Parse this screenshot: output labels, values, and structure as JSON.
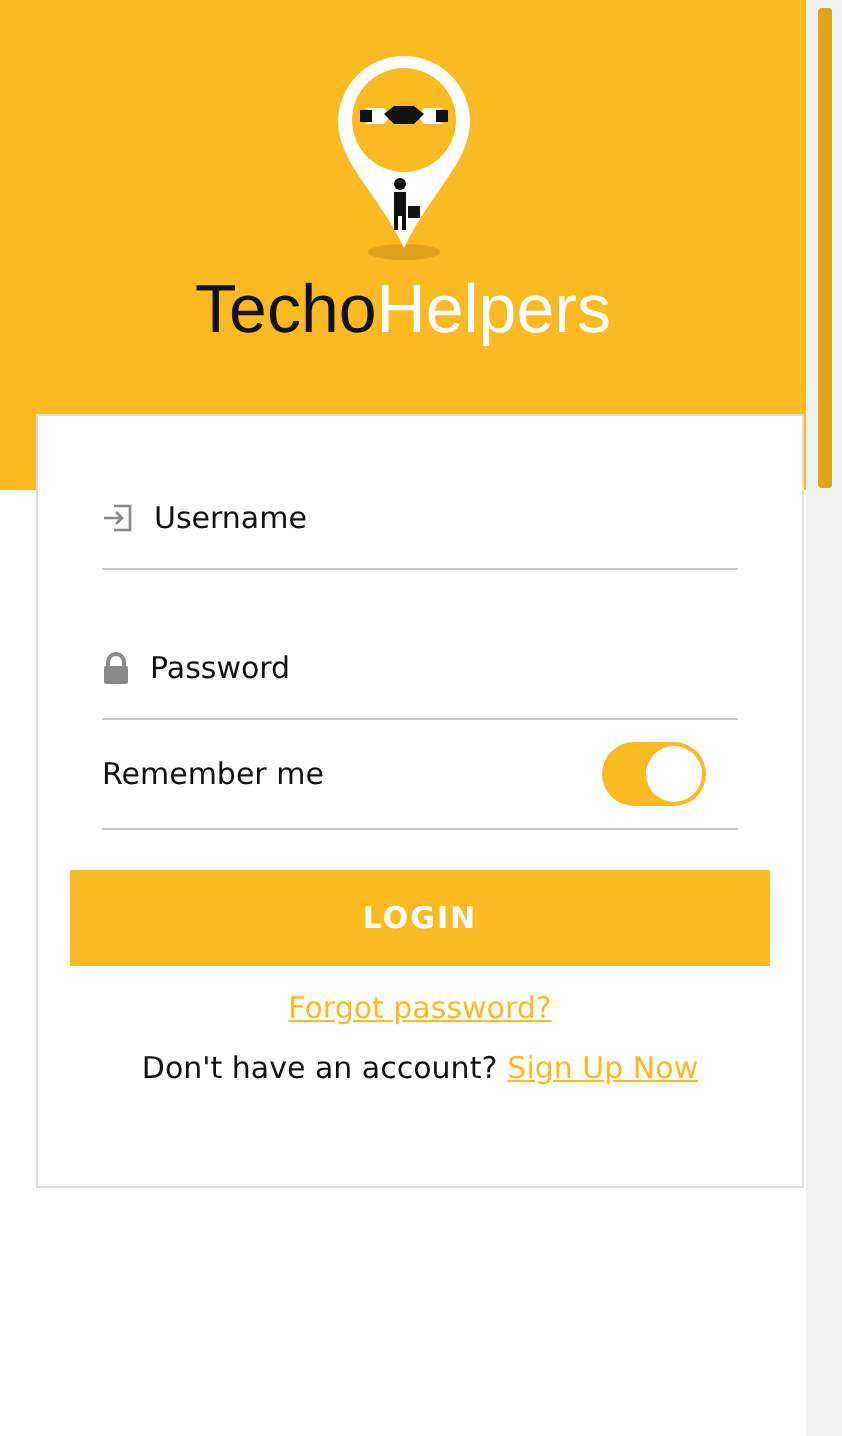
{
  "brand": {
    "name_dark": "Techo",
    "name_light": "Helpers"
  },
  "fields": [
    {
      "kind": "username",
      "placeholder": "Username"
    },
    {
      "kind": "password",
      "placeholder": "Password"
    }
  ],
  "remember": {
    "label": "Remember me",
    "on": true
  },
  "login_button": "LOGIN",
  "forgot_link": "Forgot password?",
  "signup": {
    "prompt": "Don't have an account?",
    "link": "Sign Up Now"
  }
}
